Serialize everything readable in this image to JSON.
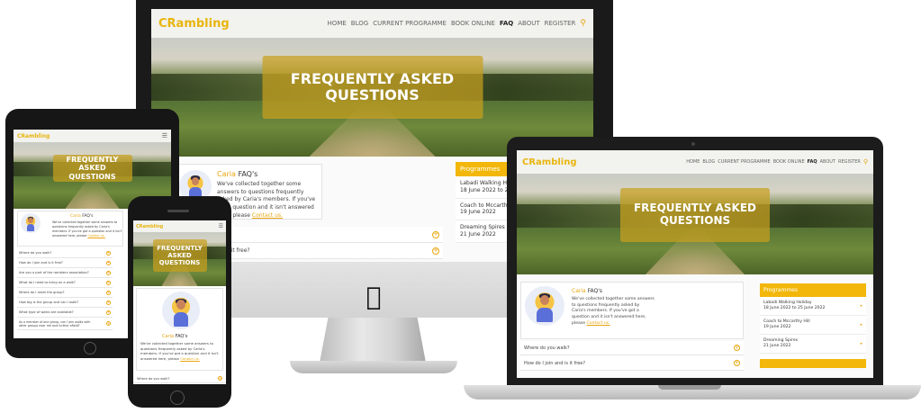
{
  "site": {
    "logo": "CRambling",
    "hero_title": "FREQUENTLY ASKED QUESTIONS",
    "nav_items": [
      "HOME",
      "BLOG",
      "CURRENT PROGRAMME",
      "BOOK ONLINE",
      "FAQ",
      "ABOUT",
      "REGISTER"
    ],
    "active_nav": "FAQ",
    "accent_color": "#f2b70a",
    "search_icon": "search-icon"
  },
  "intro": {
    "title_brand": "Caria",
    "title_suffix": "FAQ's",
    "text": "We've collected together some answers to questions frequently asked by Caria's members. If you've got a question and it isn't answered here, please",
    "link_text": "Contact us."
  },
  "faq_items": [
    "Where do you walk?",
    "How do I join and is it free?",
    "Are you a part of the ramblers association?",
    "What do I need to bring on a walk?",
    "Where do I meet the group?",
    "How big is the group and can I walk?",
    "What type of walks are available?",
    "As a member of one group, can I join walks with other groups near me and further afield?"
  ],
  "programmes": {
    "heading": "Programmes",
    "items": [
      {
        "name": "Labadi Walking Holiday",
        "date": "18 June 2022 to 25 June 2022"
      },
      {
        "name": "Coach to Mccarthy Hill",
        "date": "19 June 2022"
      },
      {
        "name": "Dreaming Spires",
        "date": "21 June 2022"
      }
    ]
  }
}
